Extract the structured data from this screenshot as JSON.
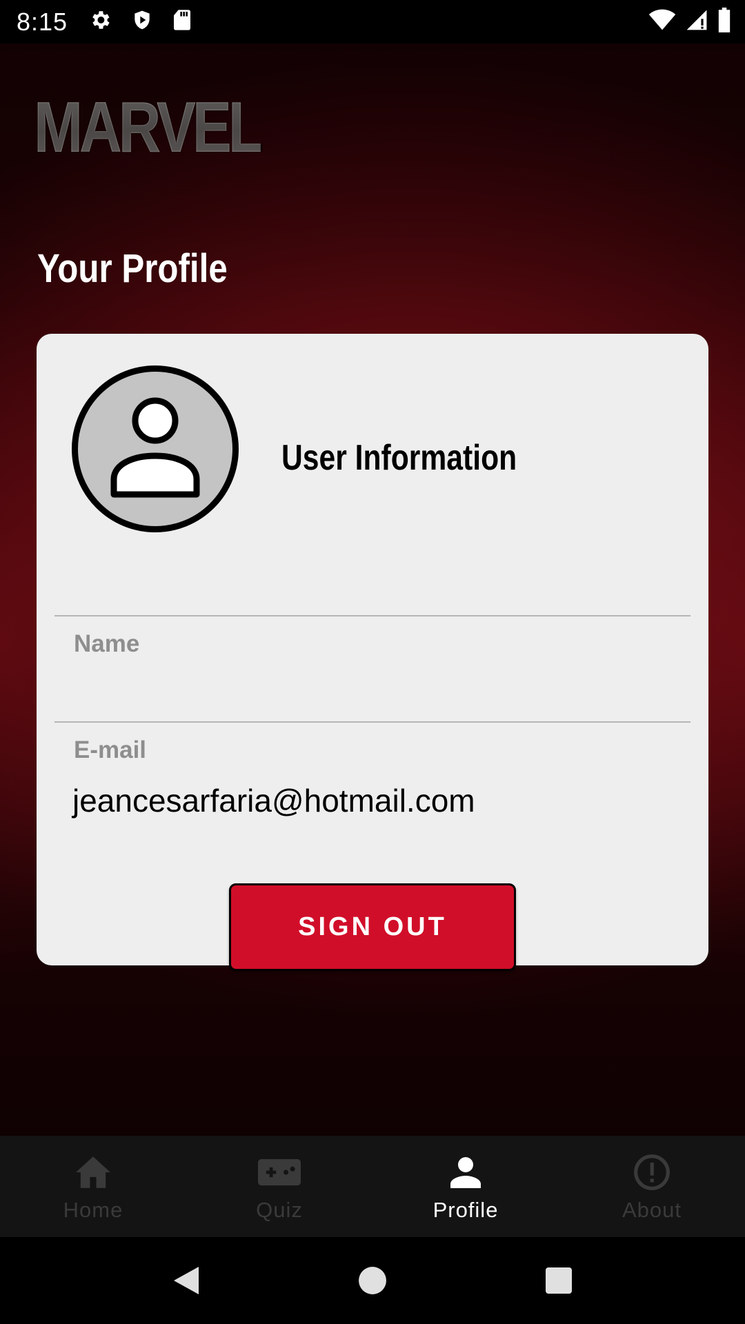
{
  "status_bar": {
    "time": "8:15",
    "left_icons": [
      "gear-icon",
      "shield-play-icon",
      "sd-card-icon"
    ],
    "right_icons": [
      "wifi-icon",
      "signal-icon",
      "battery-icon"
    ]
  },
  "header": {
    "logo_text": "MARVEL",
    "page_title": "Your Profile"
  },
  "card": {
    "heading": "User Information",
    "avatar_icon": "account-icon",
    "fields": {
      "name_label": "Name",
      "name_value": "",
      "email_label": "E-mail",
      "email_value": "jeancesarfaria@hotmail.com"
    },
    "sign_out_label": "SIGN OUT"
  },
  "bottom_nav": {
    "items": [
      {
        "label": "Home",
        "icon": "home-icon",
        "active": false
      },
      {
        "label": "Quiz",
        "icon": "gamepad-icon",
        "active": false
      },
      {
        "label": "Profile",
        "icon": "person-icon",
        "active": true
      },
      {
        "label": "About",
        "icon": "info-alert-icon",
        "active": false
      }
    ]
  },
  "system_nav": [
    "back-icon",
    "home-circle-icon",
    "recents-icon"
  ],
  "colors": {
    "accent": "#d10e29",
    "card_bg": "#eeeeee",
    "nav_bg": "#141414",
    "nav_active": "#ffffff",
    "nav_inactive": "#3a3a3a"
  }
}
